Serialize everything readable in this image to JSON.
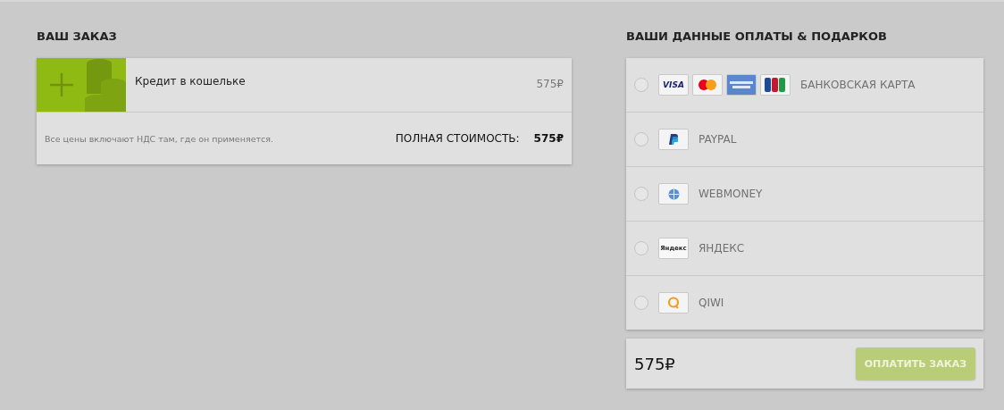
{
  "order": {
    "title": "ВАШ ЗАКАЗ",
    "items": [
      {
        "name": "Кредит в кошельке",
        "price": "575₽"
      }
    ],
    "note": "Все цены включают НДС там, где он применяется.",
    "total_label": "ПОЛНАЯ СТОИМОСТЬ:",
    "total": "575₽"
  },
  "payment": {
    "title": "ВАШИ ДАННЫЕ ОПЛАТЫ & ПОДАРКОВ",
    "methods": [
      {
        "label": "БАНКОВСКАЯ КАРТА",
        "selected": false,
        "logos": [
          {
            "kind": "visa",
            "text": "VISA"
          },
          {
            "kind": "mastercard"
          },
          {
            "kind": "amex"
          },
          {
            "kind": "jcb"
          }
        ]
      },
      {
        "label": "PAYPAL",
        "selected": false,
        "logos": [
          {
            "kind": "paypal"
          }
        ]
      },
      {
        "label": "WEBMONEY",
        "selected": false,
        "logos": [
          {
            "kind": "webmoney"
          }
        ]
      },
      {
        "label": "ЯНДЕКС",
        "selected": false,
        "logos": [
          {
            "kind": "yandex",
            "text": "Яндекс"
          }
        ]
      },
      {
        "label": "QIWI",
        "selected": false,
        "logos": [
          {
            "kind": "qiwi"
          }
        ]
      }
    ],
    "total": "575₽",
    "pay_button": {
      "label": "ОПЛАТИТЬ ЗАКАЗ",
      "disabled": true
    }
  }
}
